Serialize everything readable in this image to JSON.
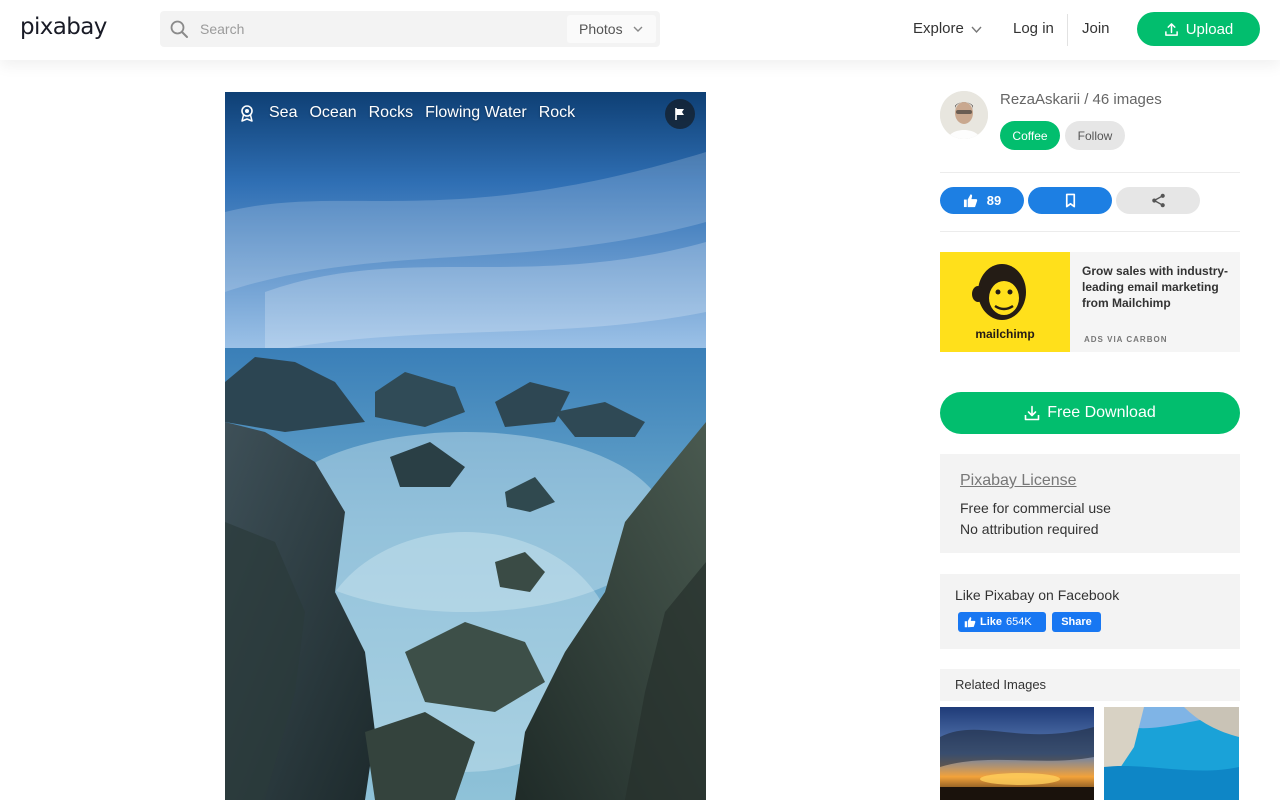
{
  "header": {
    "logo": "pixabay",
    "search_placeholder": "Search",
    "search_value": "",
    "type_select": "Photos",
    "explore": "Explore",
    "login": "Log in",
    "join": "Join",
    "upload": "Upload",
    "accent_color": "#02be6e"
  },
  "photo": {
    "tags": [
      "Sea",
      "Ocean",
      "Rocks",
      "Flowing Water",
      "Rock"
    ]
  },
  "sidebar": {
    "uploader": "RezaAskarii / 46 images",
    "coffee": "Coffee",
    "follow": "Follow",
    "likes": "89",
    "ad": {
      "brand": "mailchimp",
      "text": "Grow sales with industry-leading email marketing from Mailchimp",
      "via": "ADS VIA CARBON"
    },
    "download": "Free Download",
    "license": {
      "link": "Pixabay License",
      "line1": "Free for commercial use",
      "line2": "No attribution required"
    },
    "facebook": {
      "title": "Like Pixabay on Facebook",
      "like": "Like",
      "count": "654K",
      "share": "Share"
    },
    "related_title": "Related Images"
  },
  "colors": {
    "blue": "#1d7fe3",
    "facebook": "#1877f2",
    "mailchimp_yellow": "#ffe01b"
  }
}
